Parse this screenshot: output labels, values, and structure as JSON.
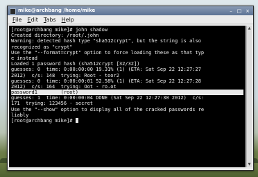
{
  "window": {
    "title": "mike@archbang /home/mike",
    "controls": [
      "minimize-icon",
      "maximize-icon",
      "close-icon"
    ]
  },
  "menu": {
    "file": "File",
    "edit": "Edit",
    "tabs": "Tabs",
    "help": "Help"
  },
  "terminal": {
    "lines": [
      "[root@archbang mike]# john shadow",
      "Created directory: /root/.john",
      "Warning: detected hash type \"sha512crypt\", but the string is also",
      "recognized as \"crypt\"",
      "Use the \"--format=crypt\" option to force loading these as that typ",
      "e instead",
      "Loaded 1 password hash (sha512crypt [32/32])",
      "guesses: 0  time: 0:00:00:00 19.31% (1) (ETA: Sat Sep 22 12:27:27",
      "2012)  c/s: 148  trying: Root - toor2",
      "guesses: 0  time: 0:00:00:01 52.58% (1) (ETA: Sat Sep 22 12:27:28",
      "2012)  c/s: 164  trying: Oot - ro.ot",
      "password1        (root)",
      "guesses: 1  time: 0:00:00:04 DONE (Sat Sep 22 12:27:30 2012)  c/s:",
      "171  trying: 123456 - secret",
      "Use the \"--show\" option to display all of the cracked passwords re",
      "liably",
      "[root@archbang mike]# "
    ]
  }
}
